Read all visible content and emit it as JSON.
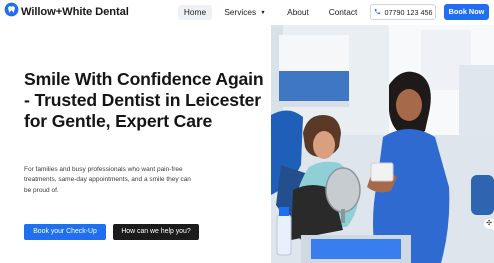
{
  "brand": {
    "name": "Willow+White Dental",
    "accent": "#1f6ff0"
  },
  "nav": {
    "items": [
      {
        "label": "Home",
        "active": true
      },
      {
        "label": "Services",
        "has_dropdown": true
      },
      {
        "label": "About"
      },
      {
        "label": "Contact"
      }
    ],
    "phone": "07790 123 456",
    "phone_icon": "phone-icon",
    "book_now": "Book Now"
  },
  "hero": {
    "title": "Smile With Confidence Again - Trusted Dentist in Leicester for Gentle, Expert Care",
    "subtitle": "For families and busy professionals who want pain-free treatments, same-day appointments, and a smile they can be proud of.",
    "primary_button": "Book your Check-Up",
    "secondary_button": "How can we help you?"
  },
  "colors": {
    "primary": "#1f6ff0",
    "dark_button": "#1b1b1b",
    "nav_active_bg": "#eef1f6"
  }
}
